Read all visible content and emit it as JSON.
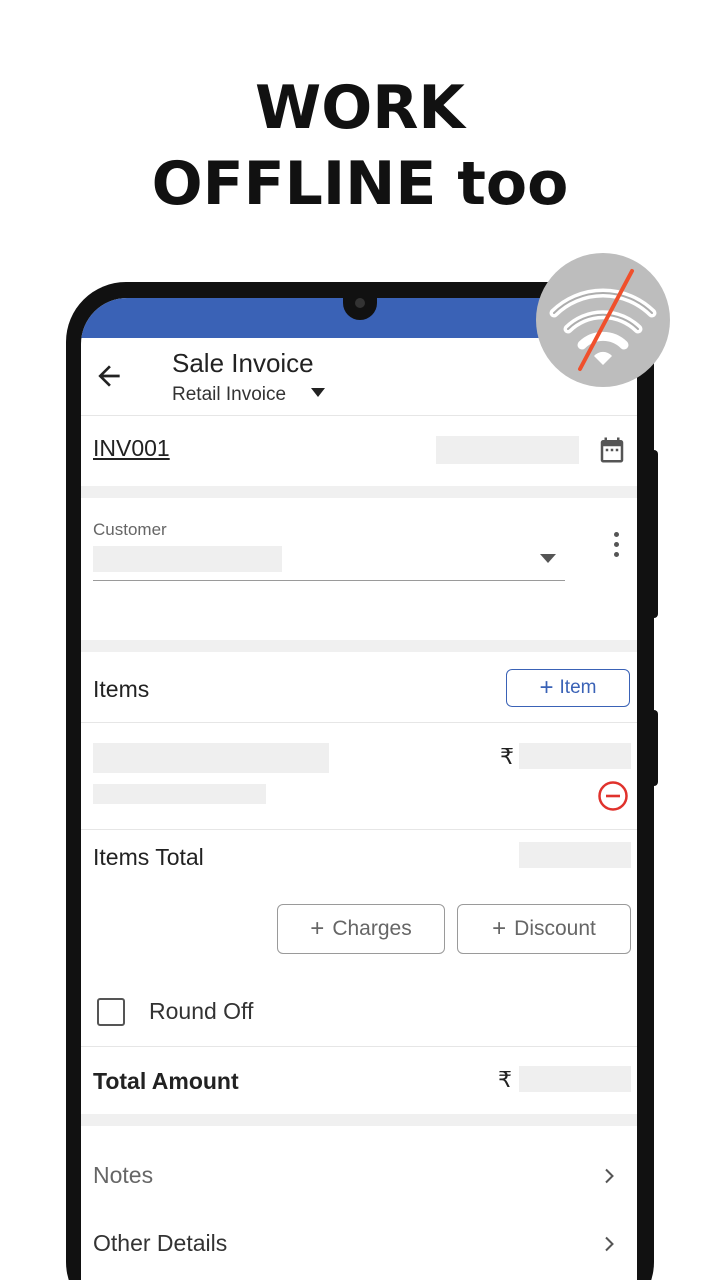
{
  "promo": {
    "line1": "WORK",
    "line2": "OFFLINE too"
  },
  "appbar": {
    "title": "Sale Invoice",
    "subtitle": "Retail Invoice",
    "back_icon": "arrow-left-icon"
  },
  "invoice": {
    "number": "INV001",
    "calendar_icon": "calendar-icon"
  },
  "customer": {
    "label": "Customer"
  },
  "items": {
    "heading": "Items",
    "add_button": "Item",
    "currency": "₹",
    "remove_icon": "minus-circle-icon"
  },
  "totals": {
    "items_total_label": "Items Total",
    "charges_button": "Charges",
    "discount_button": "Discount",
    "round_off_label": "Round Off",
    "round_off_checked": false,
    "total_amount_label": "Total Amount",
    "currency": "₹"
  },
  "sections": [
    {
      "label": "Notes"
    },
    {
      "label": "Other Details"
    }
  ],
  "badge": {
    "icon": "wifi-off-icon"
  },
  "colors": {
    "primary": "#3a62b6",
    "danger": "#e0322c",
    "slash": "#f0502c"
  }
}
